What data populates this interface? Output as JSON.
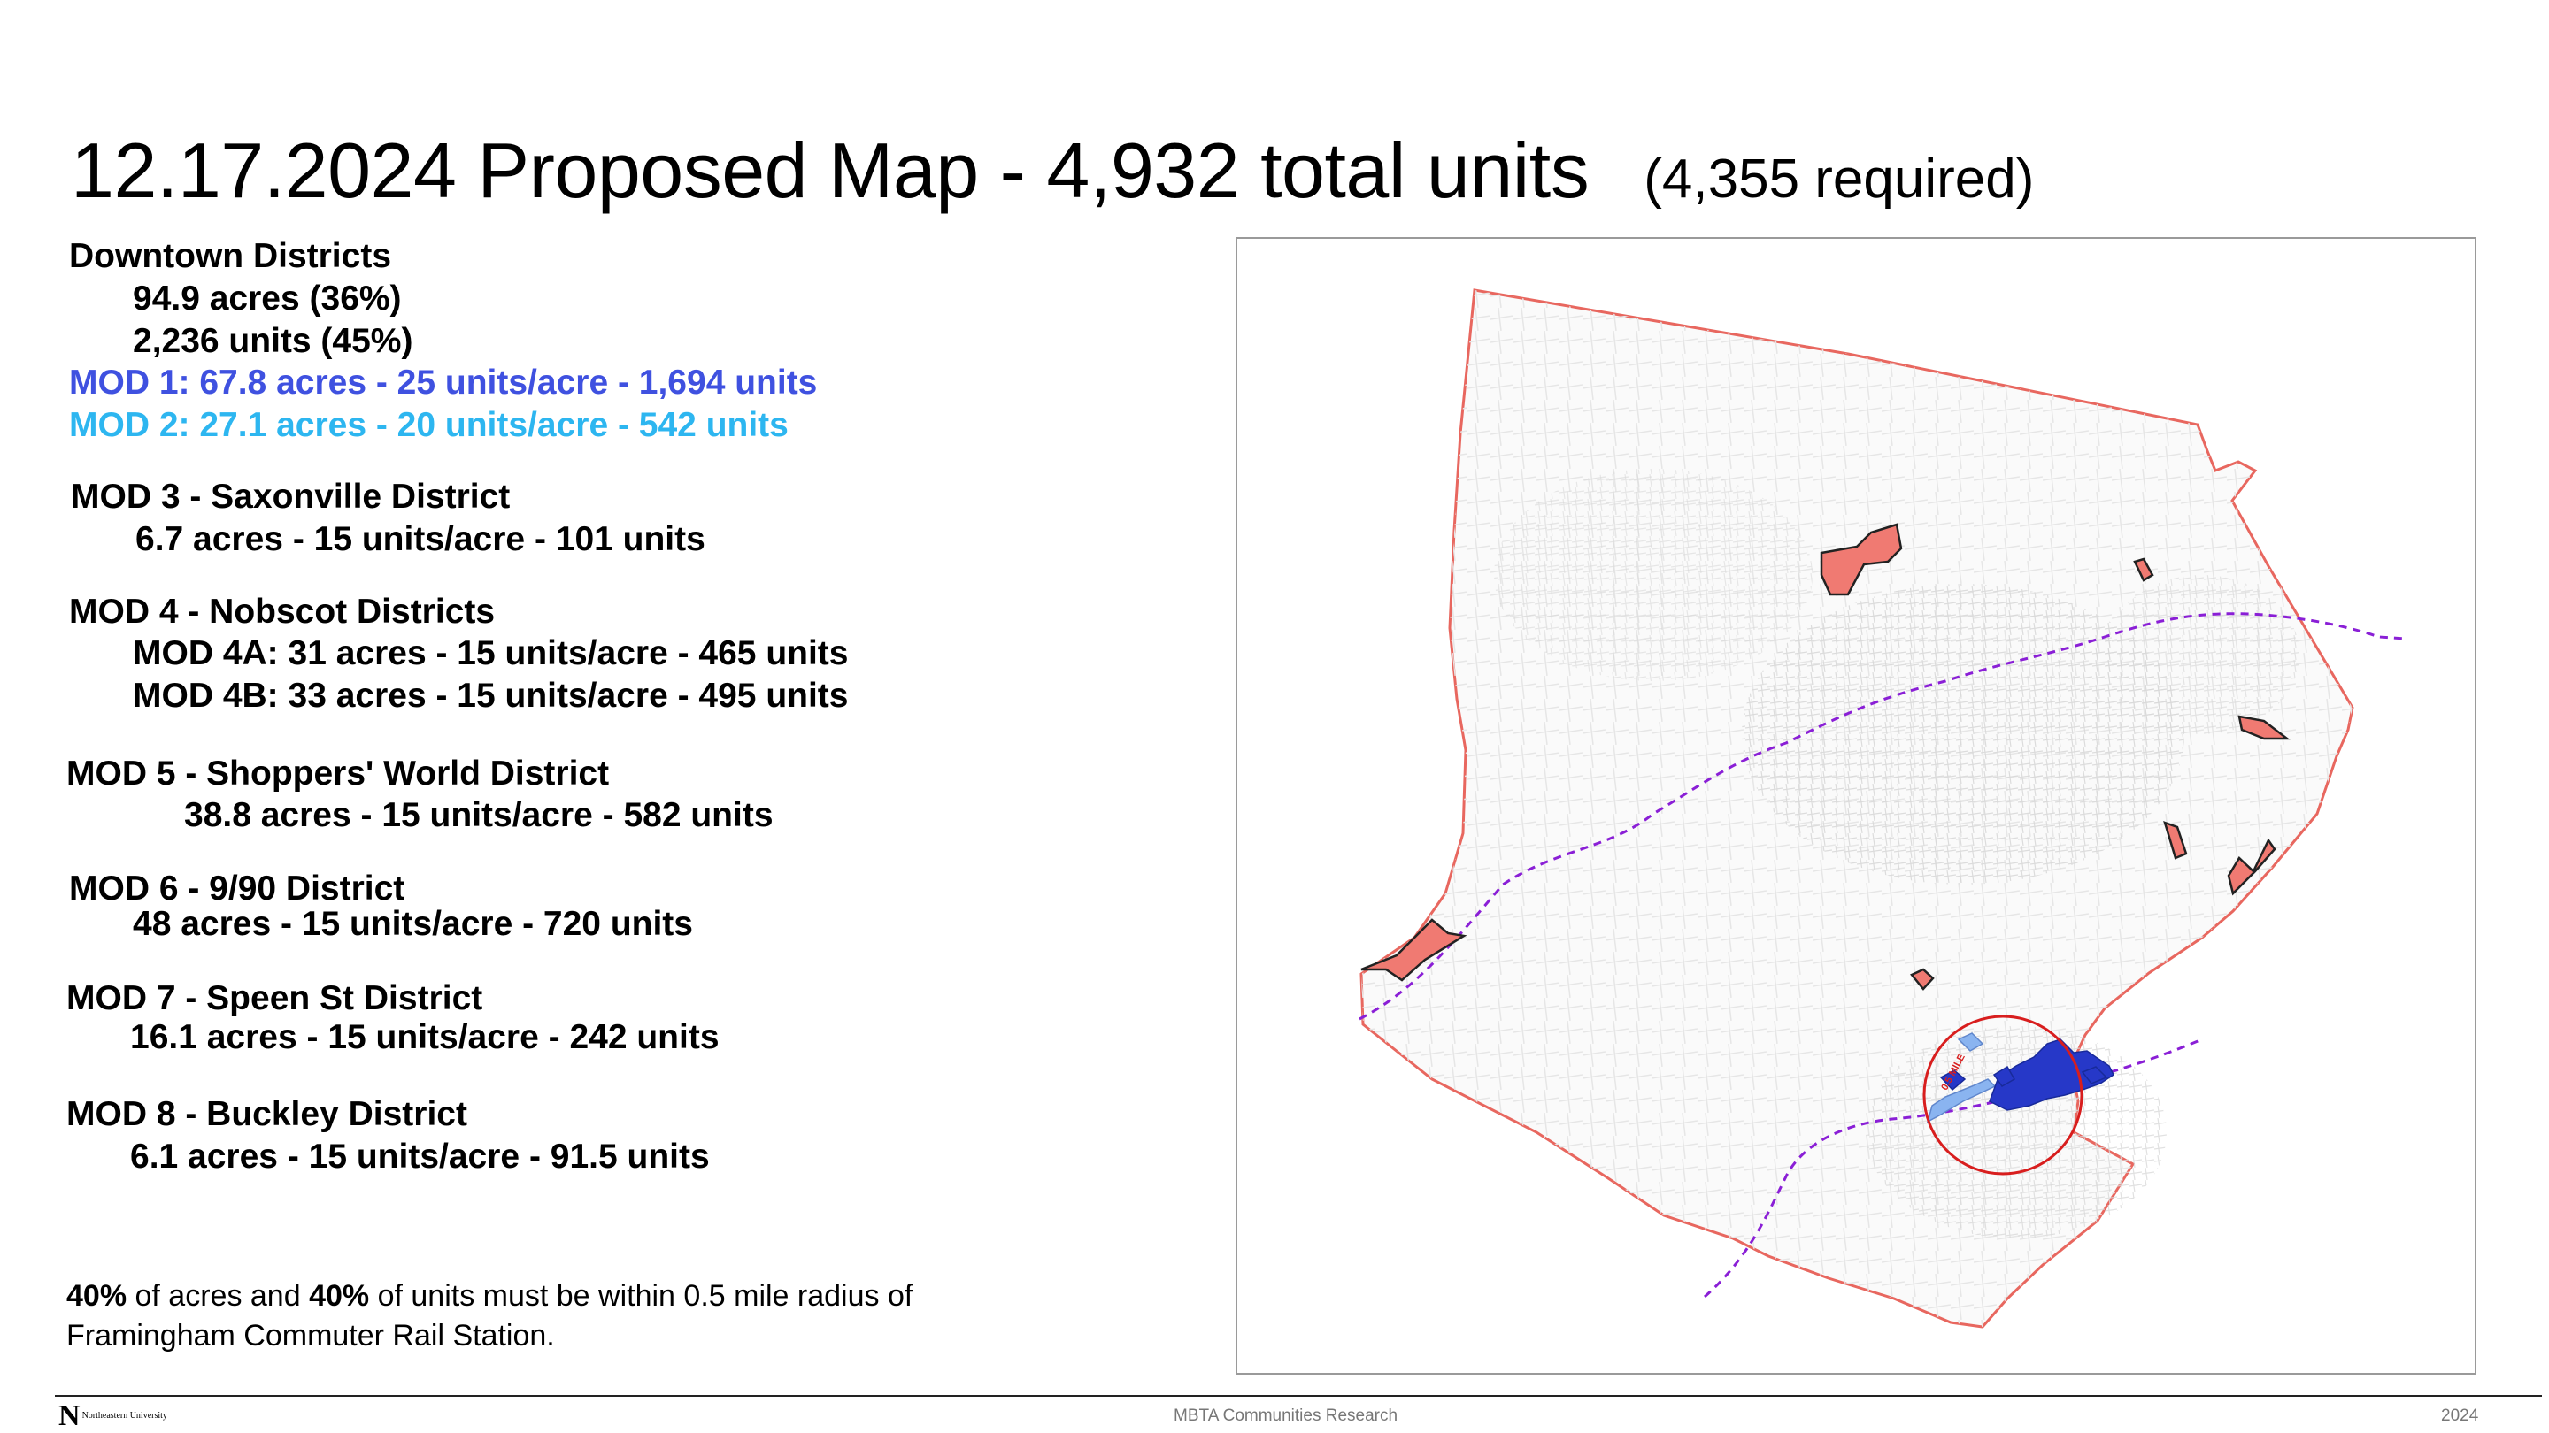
{
  "title": {
    "main": "12.17.2024 Proposed Map - 4,932 total units",
    "sub": "(4,355 required)"
  },
  "districts": {
    "downtown_header": "Downtown Districts",
    "downtown_acres": "94.9 acres (36%)",
    "downtown_units": "2,236 units (45%)",
    "mod1": "MOD 1: 67.8 acres - 25 units/acre - 1,694 units",
    "mod2": "MOD 2: 27.1 acres - 20 units/acre - 542 units",
    "mod3_header": "MOD 3 - Saxonville District",
    "mod3_detail": "6.7 acres - 15 units/acre - 101 units",
    "mod4_header": "MOD 4 - Nobscot Districts",
    "mod4a": "MOD 4A: 31 acres - 15 units/acre - 465 units",
    "mod4b": "MOD 4B: 33 acres - 15 units/acre - 495 units",
    "mod5_header": "MOD 5 - Shoppers' World District",
    "mod5_detail": "38.8 acres - 15 units/acre - 582 units",
    "mod6_header": "MOD 6 - 9/90 District",
    "mod6_detail": "48 acres - 15 units/acre - 720 units",
    "mod7_header": "MOD 7 - Speen St District",
    "mod7_detail": "16.1 acres - 15 units/acre - 242 units",
    "mod8_header": "MOD 8 - Buckley District",
    "mod8_detail": "6.1 acres - 15 units/acre - 91.5 units"
  },
  "note": {
    "pct1": "40%",
    "text1": " of acres and ",
    "pct2": "40%",
    "text2": " of units must be within 0.5 mile radius of",
    "line2": "Framingham Commuter Rail Station."
  },
  "map": {
    "radius_label": "0.5 MILE",
    "colors": {
      "boundary": "#e8675f",
      "district_fill": "#f07a72",
      "mod1": "#2638c8",
      "mod2": "#8ab4f0",
      "rail_line": "#8a1fd6",
      "radius_circle": "#d81e1e"
    }
  },
  "footer": {
    "logo_letter": "N",
    "logo_text": "Northeastern University",
    "center": "MBTA Communities Research",
    "year": "2024"
  }
}
